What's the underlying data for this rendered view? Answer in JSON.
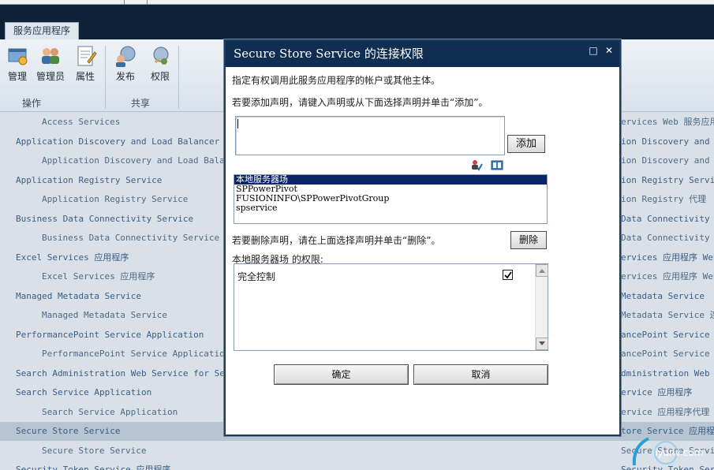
{
  "ribbon": {
    "tab_label": "服务应用程序",
    "buttons": [
      {
        "label": "管理",
        "icon": "manage-icon"
      },
      {
        "label": "管理员",
        "icon": "administrators-icon"
      },
      {
        "label": "属性",
        "icon": "properties-icon"
      },
      {
        "label": "发布",
        "icon": "publish-icon"
      },
      {
        "label": "权限",
        "icon": "permissions-icon"
      }
    ],
    "groups": [
      "操作",
      "共享"
    ]
  },
  "services_list": [
    {
      "left": "Access Services",
      "right": "ervices Web 服务应用",
      "level": 2
    },
    {
      "left": "Application Discovery and Load Balancer Serv",
      "right": "ion Discovery and Lo",
      "level": 1
    },
    {
      "left": "Application Discovery and Load Balancer",
      "right": "ion Discovery and Lo",
      "level": 2
    },
    {
      "left": "Application Registry Service",
      "right": "ion Registry Service",
      "level": 1
    },
    {
      "left": "Application Registry Service",
      "right": "ion Registry 代理",
      "level": 2
    },
    {
      "left": "Business Data Connectivity Service",
      "right": "Data Connectivity Se",
      "level": 1
    },
    {
      "left": "Business Data Connectivity Service",
      "right": "Data Connectivity Se",
      "level": 2
    },
    {
      "left": "Excel Services 应用程序",
      "right": "ervices 应用程序 Web",
      "level": 1
    },
    {
      "left": "Excel Services 应用程序",
      "right": "ervices 应用程序 Web",
      "level": 2
    },
    {
      "left": "Managed Metadata Service",
      "right": "Metadata Service",
      "level": 1
    },
    {
      "left": "Managed Metadata Service",
      "right": "Metadata Service 连接",
      "level": 2
    },
    {
      "left": "PerformancePoint Service Application",
      "right": "ancePoint Service App",
      "level": 1
    },
    {
      "left": "PerformancePoint Service Application",
      "right": "ancePoint Service App",
      "level": 2
    },
    {
      "left": "Search Administration Web Service for Search",
      "right": "dministration Web Se",
      "level": 1
    },
    {
      "left": "Search Service Application",
      "right": "ervice 应用程序",
      "level": 1
    },
    {
      "left": "Search Service Application",
      "right": "ervice 应用程序代理",
      "level": 2
    },
    {
      "left": "Secure Store Service",
      "right": "tore Service 应用程序",
      "level": 1,
      "selected": true
    },
    {
      "left": "Secure Store Service",
      "right": "Secure Store Service",
      "level": 2
    },
    {
      "left": "Security Token Service 应用程序",
      "right": "Security Token Service",
      "level": 1
    }
  ],
  "watermark": {
    "text": "iyunv.com"
  },
  "dialog": {
    "title": "Secure Store Service 的连接权限",
    "maximize_glyph": "□",
    "close_glyph": "✕",
    "intro": "指定有权调用此服务应用程序的帐户或其他主体。",
    "add_instruction": "若要添加声明，请键入声明或从下面选择声明并单击“添加”。",
    "claim_input_value": "",
    "add_label": "添加",
    "claims": [
      "本地服务器场",
      "SPPowerPivot",
      "FUSIONINFO\\SPPowerPivotGroup",
      "spservice"
    ],
    "remove_instruction": "若要删除声明，请在上面选择声明并单击“删除”。",
    "remove_label": "删除",
    "permissions_heading": "本地服务器场 的权限:",
    "permissions": [
      {
        "name": "完全控制",
        "checked": true
      }
    ],
    "ok_label": "确定",
    "cancel_label": "取消"
  },
  "colors": {
    "title_bar": "#0f2e52",
    "selection": "#0a246a",
    "link_text": "#3b5e86"
  }
}
